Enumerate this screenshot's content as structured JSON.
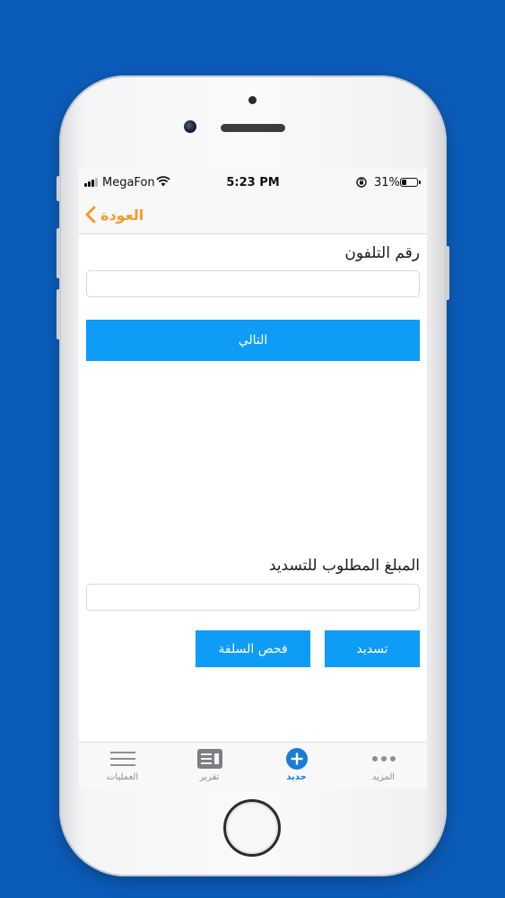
{
  "status_bar": {
    "carrier": "MegaFon",
    "time": "5:23 PM",
    "battery_percent": "31%",
    "battery_level": 0.31
  },
  "nav": {
    "back_label": "العودة",
    "accent_color": "#f39c2d"
  },
  "form": {
    "phone_label": "رقم التلفون",
    "phone_value": "",
    "next_button": "التالي",
    "amount_label": "المبلغ المطلوب للتسديد",
    "amount_value": "",
    "pay_button": "تسديد",
    "check_loan_button": "فحص السلفة",
    "button_color": "#0e9cf7"
  },
  "tabs": [
    {
      "label": "العمليات",
      "icon": "menu-lines-icon",
      "active": false
    },
    {
      "label": "تقرير",
      "icon": "report-icon",
      "active": false
    },
    {
      "label": "جديد",
      "icon": "plus-circle-icon",
      "active": true
    },
    {
      "label": "المزيد",
      "icon": "more-dots-icon",
      "active": false
    }
  ],
  "background_color": "#0b5cb9"
}
